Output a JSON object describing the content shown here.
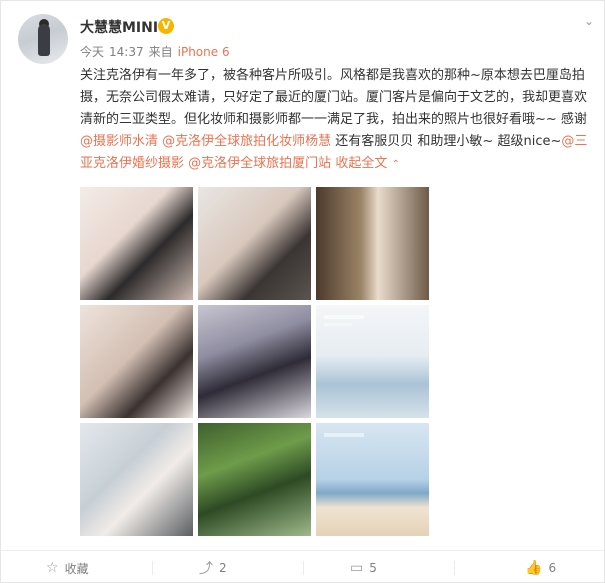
{
  "post": {
    "username": "大慧慧MINI",
    "badge": "V",
    "meta": {
      "day": "今天",
      "time": "14:37",
      "source_prefix": "来自",
      "device": "iPhone 6"
    },
    "text_parts": {
      "p1": "关注克洛伊有一年多了，被各种客片所吸引。风格都是我喜欢的那种~原本想去巴厘岛拍摄，无奈公司假太难请，只好定了最近的厦门站。厦门客片是偏向于文艺的，我却更喜欢清新的三亚类型。但化妆师和摄影师都一一满足了我，拍出来的照片也很好看哦~~ 感谢",
      "mention1": "@摄影师水清",
      "mention2": "@克洛伊全球旅拍化妆师杨慧",
      "p2": " 还有客服贝贝 和助理小敏~ 超级nice~",
      "mention3": "@三亚克洛伊婚纱摄影",
      "mention4": "@克洛伊全球旅拍厦门站",
      "collapse": "收起全文"
    },
    "photos": [
      "photo-1",
      "photo-2",
      "photo-3",
      "photo-4",
      "photo-5",
      "photo-6",
      "photo-7",
      "photo-8",
      "photo-9"
    ]
  },
  "actions": {
    "favorite_label": "收藏",
    "repost_count": "2",
    "comment_count": "5",
    "like_count": "6"
  },
  "icons": {
    "favorite": "star-icon",
    "repost": "repost-icon",
    "comment": "comment-icon",
    "like": "thumbs-up-icon",
    "menu": "chevron-down-icon"
  },
  "colors": {
    "link": "#eb7350",
    "badge": "#f7b500",
    "like": "#ff8200"
  }
}
